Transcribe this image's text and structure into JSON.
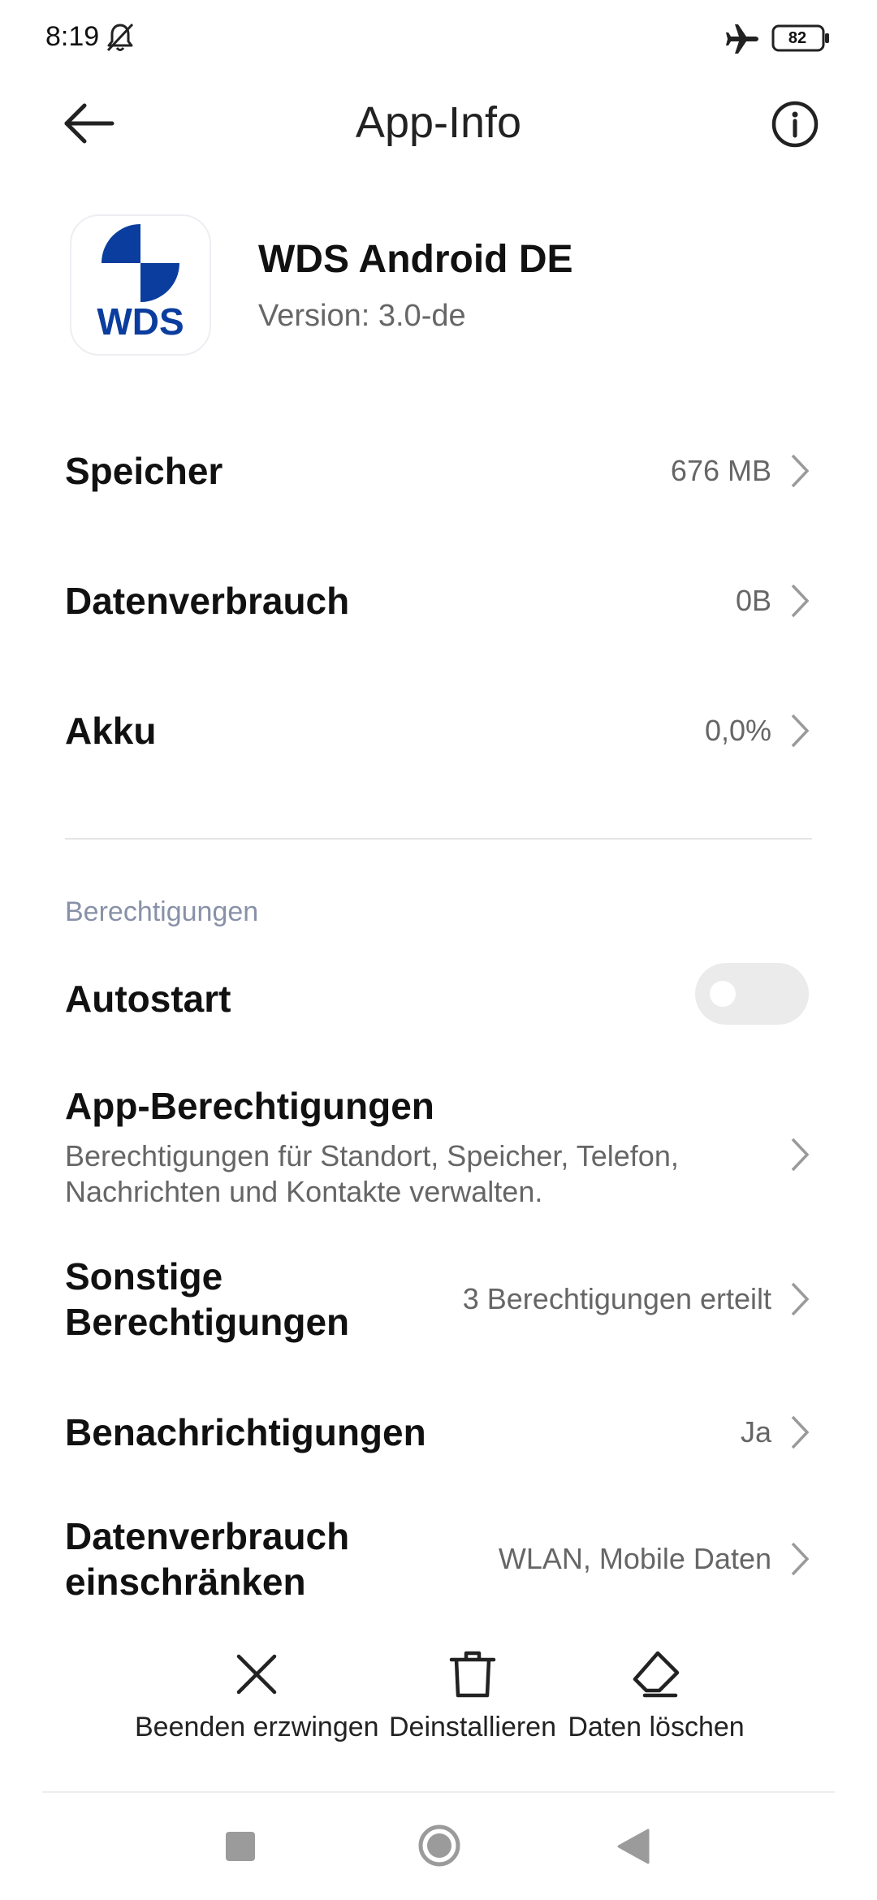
{
  "status_bar": {
    "time": "8:19",
    "battery": "82"
  },
  "header": {
    "title": "App-Info"
  },
  "app": {
    "name": "WDS Android DE",
    "version": "Version: 3.0-de",
    "logo_text": "WDS",
    "logo_color": "#0a3d9e"
  },
  "rows": {
    "storage": {
      "label": "Speicher",
      "value": "676 MB"
    },
    "data_usage": {
      "label": "Datenverbrauch",
      "value": "0B"
    },
    "battery": {
      "label": "Akku",
      "value": "0,0%"
    }
  },
  "permissions": {
    "section_title": "Berechtigungen",
    "autostart": {
      "label": "Autostart",
      "enabled": false
    },
    "app_permissions": {
      "label": "App-Berechtigungen",
      "description_line1": "Berechtigungen für Standort, Speicher, Telefon,",
      "description_line2": "Nachrichten und Kontakte verwalten."
    },
    "other_permissions": {
      "label_line1": "Sonstige",
      "label_line2": "Berechtigungen",
      "value": "3 Berechtigungen erteilt"
    },
    "notifications": {
      "label": "Benachrichtigungen",
      "value": "Ja"
    },
    "restrict_data": {
      "label_line1": "Datenverbrauch",
      "label_line2": "einschränken",
      "value": "WLAN, Mobile Daten"
    }
  },
  "actions": {
    "force_stop": "Beenden erzwingen",
    "uninstall": "Deinstallieren",
    "clear_data": "Daten löschen"
  }
}
